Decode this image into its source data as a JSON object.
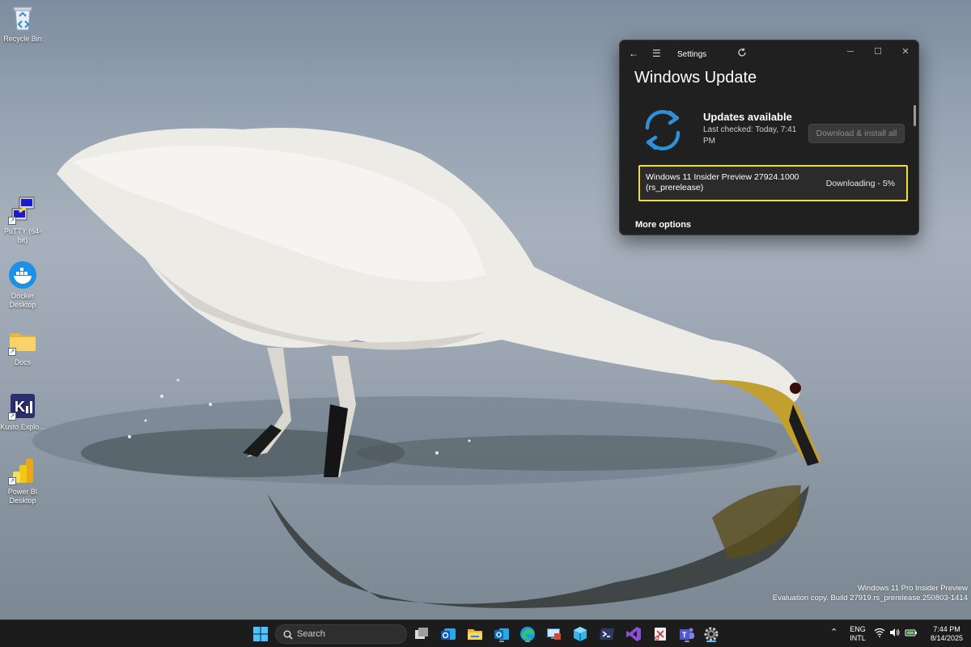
{
  "desktop": {
    "icons": [
      {
        "label": "Recycle Bin",
        "icon": "recycle-bin-icon"
      },
      {
        "label": "PuTTY (64-bit)",
        "icon": "putty-icon"
      },
      {
        "label": "Docker Desktop",
        "icon": "docker-icon"
      },
      {
        "label": "Docs",
        "icon": "folder-icon"
      },
      {
        "label": "Kusto.Explo...",
        "icon": "kusto-explorer-icon"
      },
      {
        "label": "Power BI Desktop",
        "icon": "power-bi-icon"
      }
    ]
  },
  "settings_window": {
    "app_title": "Settings",
    "page_title": "Windows Update",
    "status_title": "Updates available",
    "status_subtitle": "Last checked: Today, 7:41 PM",
    "download_button": "Download & install all",
    "update_item": {
      "name": "Windows 11 Insider Preview 27924.1000 (rs_prerelease)",
      "status": "Downloading - 5%",
      "progress_percent": 5
    },
    "more_options": "More options",
    "highlight_color": "#f1de39",
    "accent_color": "#2f8fd8"
  },
  "watermark": {
    "line1": "Windows 11 Pro Insider Preview",
    "line2": "Evaluation copy. Build 27919.rs_prerelease.250803-1414"
  },
  "taskbar": {
    "search_placeholder": "Search",
    "apps": [
      "start-icon",
      "task-view-icon",
      "outlook-new-icon",
      "file-explorer-icon",
      "outlook-icon",
      "edge-icon",
      "remote-desktop-icon",
      "azure-data-icon",
      "powershell-icon",
      "visual-studio-icon",
      "snipping-tool-icon",
      "teams-icon",
      "settings-icon"
    ],
    "language_line1": "ENG",
    "language_line2": "INTL",
    "time": "7:44 PM",
    "date": "8/14/2025"
  }
}
